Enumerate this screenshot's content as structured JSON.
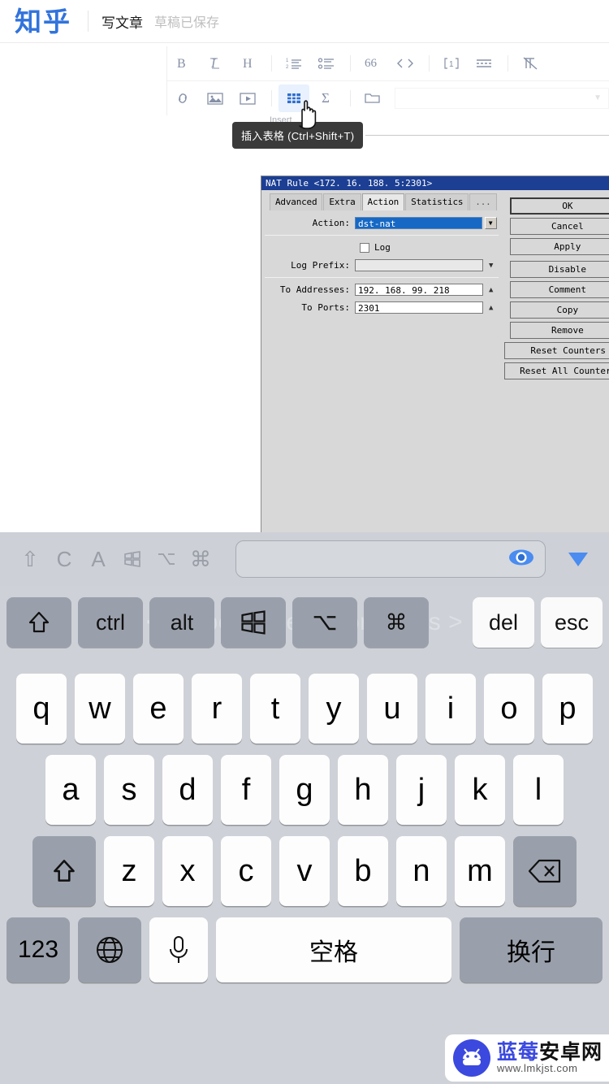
{
  "header": {
    "logo": "知乎",
    "write_label": "写文章",
    "draft_status": "草稿已保存"
  },
  "toolbar": {
    "row1": [
      {
        "name": "bold",
        "glyph": "B"
      },
      {
        "name": "italic",
        "glyph": "I"
      },
      {
        "name": "heading",
        "glyph": "H"
      },
      {
        "name": "ordered-list",
        "glyph": "1."
      },
      {
        "name": "bullet-list",
        "glyph": "•"
      },
      {
        "name": "blockquote",
        "glyph": "66"
      },
      {
        "name": "code-block",
        "glyph": "</>"
      },
      {
        "name": "footnote",
        "glyph": "[1]"
      },
      {
        "name": "divider",
        "glyph": "≡"
      },
      {
        "name": "clear-format",
        "glyph": "X"
      }
    ],
    "row2": [
      {
        "name": "link",
        "glyph": "🔗"
      },
      {
        "name": "image",
        "glyph": "🖼"
      },
      {
        "name": "video",
        "glyph": "▶"
      },
      {
        "name": "table",
        "glyph": "▦"
      },
      {
        "name": "formula",
        "glyph": "Σ"
      },
      {
        "name": "folder",
        "glyph": "📁"
      }
    ],
    "active_button": "table",
    "tooltip": "插入表格 (Ctrl+Shift+T)",
    "ghost_label": "Insert"
  },
  "nat_dialog": {
    "title": "NAT Rule <172. 16. 188. 5:2301>",
    "tabs": [
      {
        "label": "Advanced",
        "active": false
      },
      {
        "label": "Extra",
        "active": false
      },
      {
        "label": "Action",
        "active": true
      },
      {
        "label": "Statistics",
        "active": false
      },
      {
        "label": "...",
        "active": false
      }
    ],
    "fields": {
      "action_label": "Action:",
      "action_value": "dst-nat",
      "log_label": "Log",
      "log_checked": false,
      "log_prefix_label": "Log Prefix:",
      "log_prefix_value": "",
      "to_addresses_label": "To Addresses:",
      "to_addresses_value": "192. 168. 99. 218",
      "to_ports_label": "To Ports:",
      "to_ports_value": "2301"
    },
    "buttons": [
      "OK",
      "Cancel",
      "Apply",
      "Disable",
      "Comment",
      "Copy",
      "Remove",
      "Reset Counters",
      "Reset All Counters"
    ]
  },
  "keyboard": {
    "accessory_icons": [
      "shift-up",
      "C",
      "A",
      "windows",
      "option",
      "command"
    ],
    "accessory_field_value": "",
    "eye_icon": "eye-icon",
    "dismiss_icon": "chevron-down-icon",
    "hint_text": "< swipe to view more keys >",
    "modifier_keys": [
      {
        "label": "⇧",
        "style": "dark"
      },
      {
        "label": "ctrl",
        "style": "dark"
      },
      {
        "label": "alt",
        "style": "dark"
      },
      {
        "label": "⊞",
        "style": "dark"
      },
      {
        "label": "⌥",
        "style": "dark"
      },
      {
        "label": "⌘",
        "style": "dark"
      },
      {
        "label": "del",
        "style": "light"
      },
      {
        "label": "esc",
        "style": "light"
      }
    ],
    "row_q": [
      "q",
      "w",
      "e",
      "r",
      "t",
      "y",
      "u",
      "i",
      "o",
      "p"
    ],
    "row_a": [
      "a",
      "s",
      "d",
      "f",
      "g",
      "h",
      "j",
      "k",
      "l"
    ],
    "row_z": [
      "z",
      "x",
      "c",
      "v",
      "b",
      "n",
      "m"
    ],
    "shift_key": "⇧",
    "backspace_key": "⌫",
    "num_key": "123",
    "globe_key": "🌐",
    "mic_key": "🎙",
    "space_key": "空格",
    "enter_key": "换行"
  },
  "watermark": {
    "title_blue": "蓝莓",
    "title_black": "安卓网",
    "url": "www.lmkjst.com"
  },
  "colors": {
    "zhihu_blue": "#3273dc",
    "toolbar_icon": "#8590a6",
    "active_blue": "#2f6fd0",
    "dialog_title_bg": "#1c3f94",
    "keyboard_bg": "#ced1d7",
    "key_dark": "#9aa0ab"
  }
}
